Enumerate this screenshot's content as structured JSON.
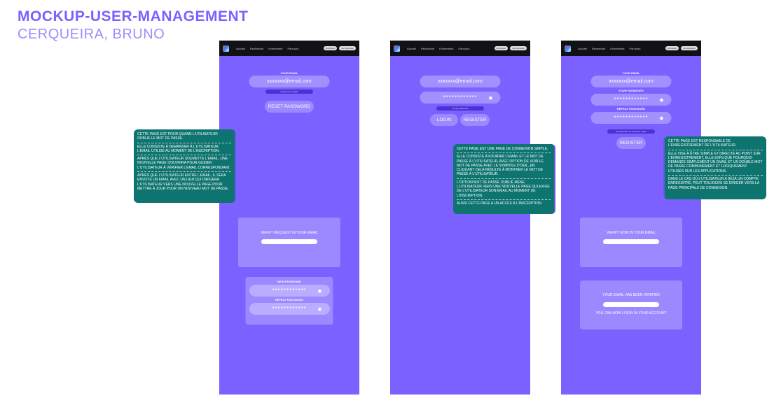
{
  "header": {
    "title": "MOCKUP-USER-MANAGEMENT",
    "author": "CERQUEIRA, BRUNO"
  },
  "nav": {
    "items": [
      "Accueil",
      "Recherche",
      "Evenement",
      "Parcours"
    ],
    "buttons": [
      "Inscription",
      "Se connecter"
    ]
  },
  "reset": {
    "email_label": "YOUR EMAIL",
    "email_value": "xxxxxxx@email.com",
    "forgot_link": "Forgot your email?",
    "reset_button": "RESET PASSWORD",
    "verify_text": "VERIFY REQUEST IN YOUR EMAIL",
    "new_pw_label": "NEW PASSWORD",
    "repeat_pw_label": "REPEAT PASSWORD",
    "pw_mask": "************"
  },
  "login": {
    "email_value": "xxxxxxx@email.com",
    "pw_mask": "************",
    "forgot_link": "Forgot password",
    "login_button": "LOGIN",
    "register_button": "REGISTER"
  },
  "register": {
    "email_label": "YOUR EMAIL",
    "email_value": "xxxxxxx@email.com",
    "pw_label": "YOUR PASSWORD",
    "repeat_label": "REPEAT PASSWORD",
    "pw_mask": "************",
    "login_link": "Already have an account? Login",
    "register_button": "REGISTER",
    "verify_text": "VERIFY NOW IN YOUR EMAIL",
    "verified_text": "YOUR EMAIL HAS BEEN VERIFIED",
    "login_now_text": "YOU CAN NOW LOGIN IN YOUR ACCOUNT"
  },
  "notes": {
    "reset": [
      "CETTE PAGE EST POUR QUAND L'UTILISATEUR OUBLIE LE MOT DE PASSE.",
      "ELLE CONSISTE À DEMANDER À L'UTILISATEUR L'EMAIL UTILISÉ AU MOMENT DE L'INSCRIPTION.",
      "APRÈS QUE L'UTILISATEUR SOUMETTE L'EMAIL, UNE NOUVELLE PAGE S'OUVRIRA POUR GUIDER L'UTILISATEUR À VÉRIFIER L'EMAIL CORRESPONDANT.",
      "APRÈS QUE L'UTILISATEUR ENTRE L'EMAIL, IL SERA ENVOYÉ UN EMAIL AVEC UN LIEN QUI DIRIGERA L'UTILISATEUR VERS UNE NOUVELLE PAGE POUR METTRE À JOUR POUR UN NOUVEAU MOT DE PASSE."
    ],
    "login": [
      "CETTE PAGE EST UNE PAGE DE CONNEXION SIMPLE.",
      "ELLE CONSISTE À FOURNIR L'EMAIL ET LE MOT DE PASSE À L'UTILISATEUR, AVEC OPTION DE VOIR LE MOT DE PASSE AVEC LE SYMBOLE D'OEIL, EN CLIQUANT CELA RÉSULTE À MONTRER LE MOT DE PASSE À L'UTILISATEUR.",
      "L'OPTION MOT DE PASSE OUBLIÉ MÈNE L'UTILISATEUR VERS UNE NOUVELLE PAGE QUI EXIGE DE L'UTILISATEUR SON EMAIL AU MOMENT DE L'INSCRIPTION.",
      "AUSSI CETTE PAGE A UN ACCÈS À L'INSCRIPTION."
    ],
    "register": [
      "CETTE PAGE EST RESPONSABLE DE L'ENREGISTREMENT DE L'UTILISATEUR.",
      "ELLE VISE À ÊTRE SIMPLE ET DIRECTE AU POINT SUR L'ENREGISTREMENT, ELLE EXPLIQUE POURQUOI DEMANDE SIMPLEMENT UN EMAIL ET UN DOUBLE MOT DE PASSE COMMUNÉMENT ET LOGIQUEMENT UTILISÉS SUR LES APPLICATIONS.",
      "DANS LE CAS OÙ L'UTILISATEUR A DÉJÀ UN COMPTE ENREGISTRÉ, PEUT TOUJOURS SE DIRIGER VERS LA PAGE PRINCIPALE DE CONNEXION."
    ]
  }
}
